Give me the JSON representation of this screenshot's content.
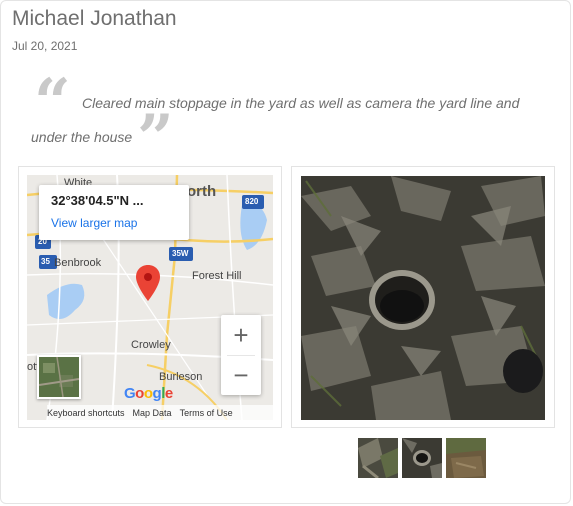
{
  "review": {
    "reviewer_name": "Michael Jonathan",
    "date": "Jul 20, 2021",
    "quote_open": "“",
    "quote_close": "”",
    "text": "Cleared main stoppage in the yard as well as camera the yard line and under the house"
  },
  "map": {
    "coordinates": "32°38'04.5\"N ...",
    "view_larger": "View larger map",
    "zoom_in": "+",
    "zoom_out": "−",
    "labels": {
      "white": "White",
      "orth": "orth",
      "benbrook": "Benbrook",
      "forest_hill": "Forest Hill",
      "crowley": "Crowley",
      "burleson": "Burleson",
      "ott": "ott"
    },
    "shields": {
      "i820": "820",
      "i35w": "35W",
      "i20": "20",
      "i35": "35"
    },
    "footer": {
      "shortcuts": "Keyboard shortcuts",
      "map_data": "Map Data",
      "terms": "Terms of Use"
    },
    "logo": [
      "G",
      "o",
      "o",
      "g",
      "l",
      "e"
    ],
    "logo_colors": [
      "#4285f4",
      "#ea4335",
      "#fbbc05",
      "#4285f4",
      "#34a853",
      "#ea4335"
    ],
    "pin_color": "#ea4335"
  },
  "photos": {
    "main_alt": "cleanout pipe in yard",
    "thumbnails": [
      "photo-1",
      "photo-2",
      "photo-3"
    ]
  }
}
